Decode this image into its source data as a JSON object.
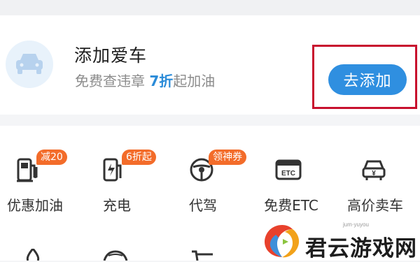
{
  "add_car": {
    "title": "添加爱车",
    "subtitle_prefix": "免费查违章 ",
    "subtitle_highlight": "7折",
    "subtitle_suffix": "起加油",
    "button_label": "去添加"
  },
  "services": [
    {
      "label": "优惠加油",
      "badge": "减20",
      "icon": "fuel-pump-icon"
    },
    {
      "label": "充电",
      "badge": "6折起",
      "icon": "charging-icon"
    },
    {
      "label": "代驾",
      "badge": "领神券",
      "icon": "steering-wheel-icon"
    },
    {
      "label": "免费ETC",
      "badge": "",
      "icon": "etc-card-icon"
    },
    {
      "label": "高价卖车",
      "badge": "",
      "icon": "sell-car-icon"
    }
  ],
  "watermark": {
    "text": "君云游戏网",
    "url": "jum·yuyou"
  },
  "colors": {
    "accent": "#2f8fe0",
    "badge": "#f36c2a",
    "highlight_box": "#c8102e"
  }
}
